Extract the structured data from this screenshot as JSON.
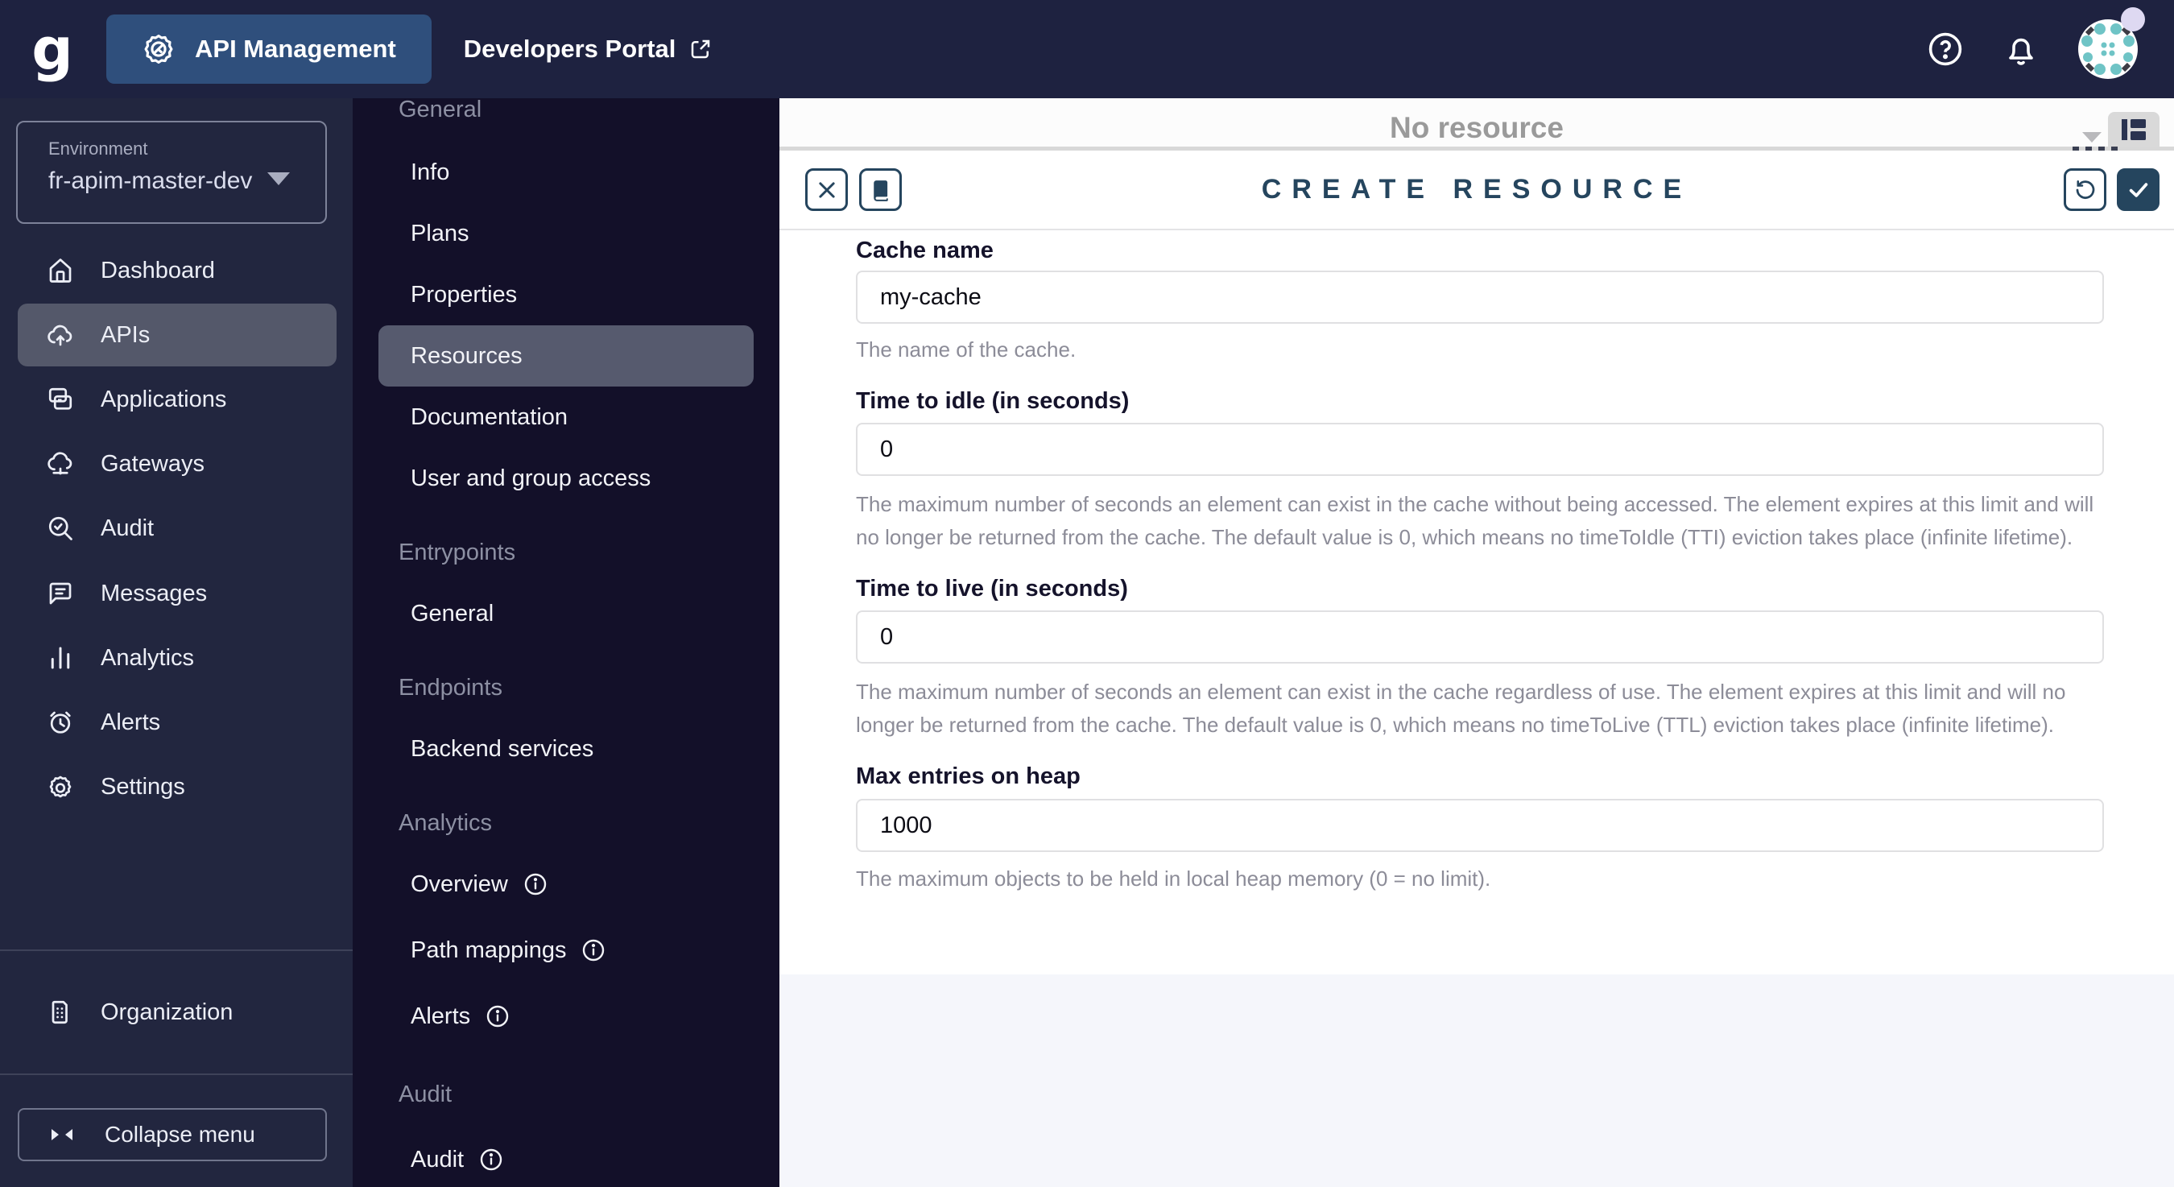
{
  "topbar": {
    "logo": "g",
    "app_button": "API Management",
    "portal_link": "Developers Portal"
  },
  "environment": {
    "label": "Environment",
    "value": "fr-apim-master-dev"
  },
  "sidebar": {
    "items": [
      "Dashboard",
      "APIs",
      "Applications",
      "Gateways",
      "Audit",
      "Messages",
      "Analytics",
      "Alerts",
      "Settings"
    ],
    "selected": "APIs",
    "organization": "Organization",
    "collapse_label": "Collapse menu"
  },
  "submenu": {
    "selected": "Resources",
    "sections": [
      {
        "title": "General",
        "items": [
          "Info",
          "Plans",
          "Properties",
          "Resources",
          "Documentation",
          "User and group access"
        ]
      },
      {
        "title": "Entrypoints",
        "items": [
          "General"
        ]
      },
      {
        "title": "Endpoints",
        "items": [
          "Backend services"
        ]
      },
      {
        "title": "Analytics",
        "items": [
          "Overview",
          "Path mappings",
          "Alerts"
        ]
      },
      {
        "title": "Audit",
        "items": [
          "Audit"
        ]
      }
    ]
  },
  "main": {
    "empty_state": "No resource",
    "panel_title": "CREATE RESOURCE",
    "form": {
      "fields": [
        {
          "label": "Cache name",
          "value": "my-cache",
          "hint": "The name of the cache."
        },
        {
          "label": "Time to idle (in seconds)",
          "value": "0",
          "hint": "The maximum number of seconds an element can exist in the cache without being accessed. The element expires at this limit and will no longer be returned from the cache. The default value is 0, which means no timeToIdle (TTI) eviction takes place (infinite lifetime)."
        },
        {
          "label": "Time to live (in seconds)",
          "value": "0",
          "hint": "The maximum number of seconds an element can exist in the cache regardless of use. The element expires at this limit and will no longer be returned from the cache. The default value is 0, which means no timeToLive (TTL) eviction takes place (infinite lifetime)."
        },
        {
          "label": "Max entries on heap",
          "value": "1000",
          "hint": "The maximum objects to be held in local heap memory (0 = no limit)."
        }
      ]
    }
  },
  "colors": {
    "topbar": "#1e2240",
    "sidebar": "#22263f",
    "submenu": "#131029",
    "app_button": "#2f4f7c",
    "accent": "#25455e",
    "highlight": "#54586a",
    "avatar_dot": "#6fc4c6",
    "badge": "#ded9f2"
  }
}
